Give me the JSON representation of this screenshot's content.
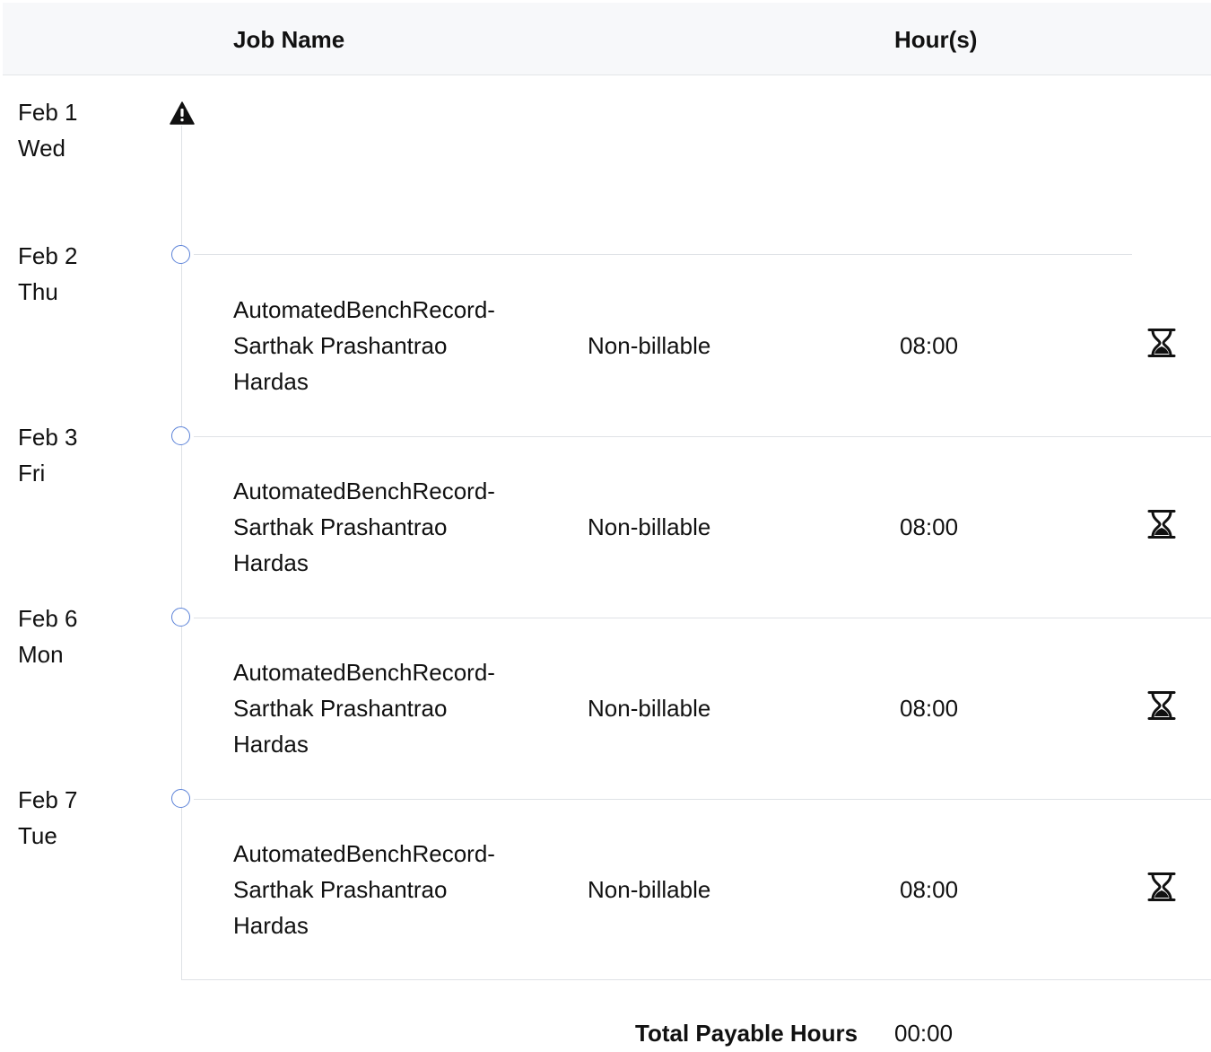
{
  "header": {
    "job_name": "Job Name",
    "hours": "Hour(s)"
  },
  "days": [
    {
      "date": "Feb 1",
      "weekday": "Wed",
      "status_icon": "warning-icon",
      "entries": []
    },
    {
      "date": "Feb 2",
      "weekday": "Thu",
      "status_icon": "circle-icon",
      "entries": [
        {
          "job_lines": [
            "AutomatedBenchRecord-",
            "Sarthak Prashantrao",
            "Hardas"
          ],
          "billing": "Non-billable",
          "hours": "08:00",
          "status_icon": "hourglass-icon"
        }
      ]
    },
    {
      "date": "Feb 3",
      "weekday": "Fri",
      "status_icon": "circle-icon",
      "entries": [
        {
          "job_lines": [
            "AutomatedBenchRecord-",
            "Sarthak Prashantrao",
            "Hardas"
          ],
          "billing": "Non-billable",
          "hours": "08:00",
          "status_icon": "hourglass-icon"
        }
      ]
    },
    {
      "date": "Feb 6",
      "weekday": "Mon",
      "status_icon": "circle-icon",
      "entries": [
        {
          "job_lines": [
            "AutomatedBenchRecord-",
            "Sarthak Prashantrao",
            "Hardas"
          ],
          "billing": "Non-billable",
          "hours": "08:00",
          "status_icon": "hourglass-icon"
        }
      ]
    },
    {
      "date": "Feb 7",
      "weekday": "Tue",
      "status_icon": "circle-icon",
      "entries": [
        {
          "job_lines": [
            "AutomatedBenchRecord-",
            "Sarthak Prashantrao",
            "Hardas"
          ],
          "billing": "Non-billable",
          "hours": "08:00",
          "status_icon": "hourglass-icon"
        }
      ]
    }
  ],
  "total": {
    "label": "Total Payable Hours",
    "value": "00:00"
  },
  "colors": {
    "accent_circle": "#5b82d8",
    "divider": "#dfe2e6",
    "header_bg": "#f7f8fa"
  }
}
